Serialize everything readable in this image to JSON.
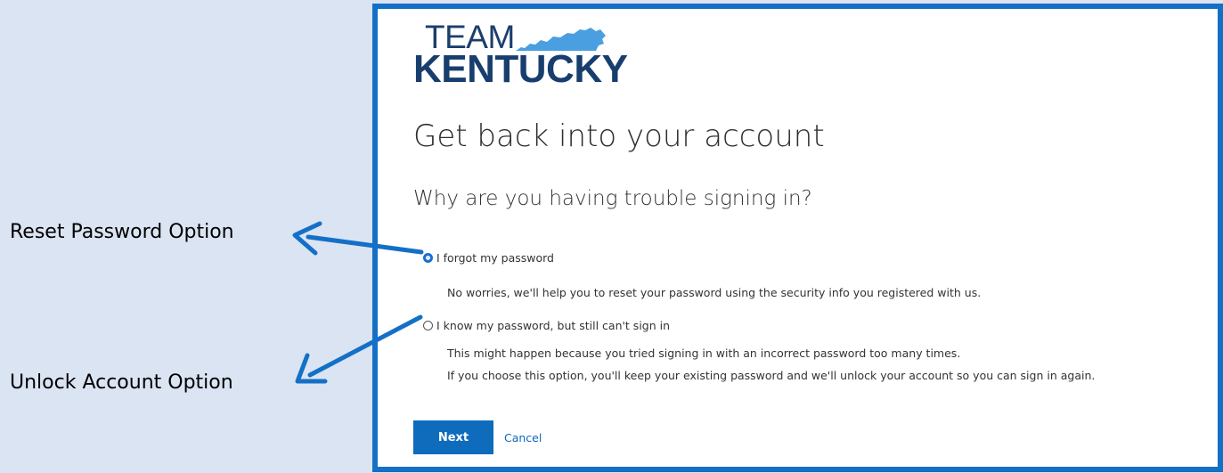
{
  "callouts": {
    "reset": "Reset Password Option",
    "unlock": "Unlock Account Option"
  },
  "logo": {
    "line1": "TEAM",
    "line2": "KENTUCKY"
  },
  "page": {
    "heading": "Get back into your account",
    "question": "Why are you having trouble signing in?"
  },
  "options": {
    "forgot": {
      "label": "I forgot my password",
      "description": "No worries, we'll help you to reset your password using the security info you registered with us.",
      "selected": true
    },
    "know": {
      "label": "I know my password, but still can't sign in",
      "description1": "This might happen because you tried signing in with an incorrect password too many times.",
      "description2": "If you choose this option, you'll keep your existing password and we'll unlock your account so you can sign in again.",
      "selected": false
    }
  },
  "actions": {
    "next": "Next",
    "cancel": "Cancel"
  },
  "colors": {
    "background": "#dbe4f2",
    "panel_border": "#1470c7",
    "brand_navy": "#173e6d",
    "brand_light_blue": "#4a9fe0",
    "button": "#0f6cbd",
    "link": "#1068b9",
    "arrow": "#1470c7"
  },
  "icons": {
    "state_shape": "kentucky-state-shape-icon",
    "arrow": "arrow-left-icon"
  }
}
